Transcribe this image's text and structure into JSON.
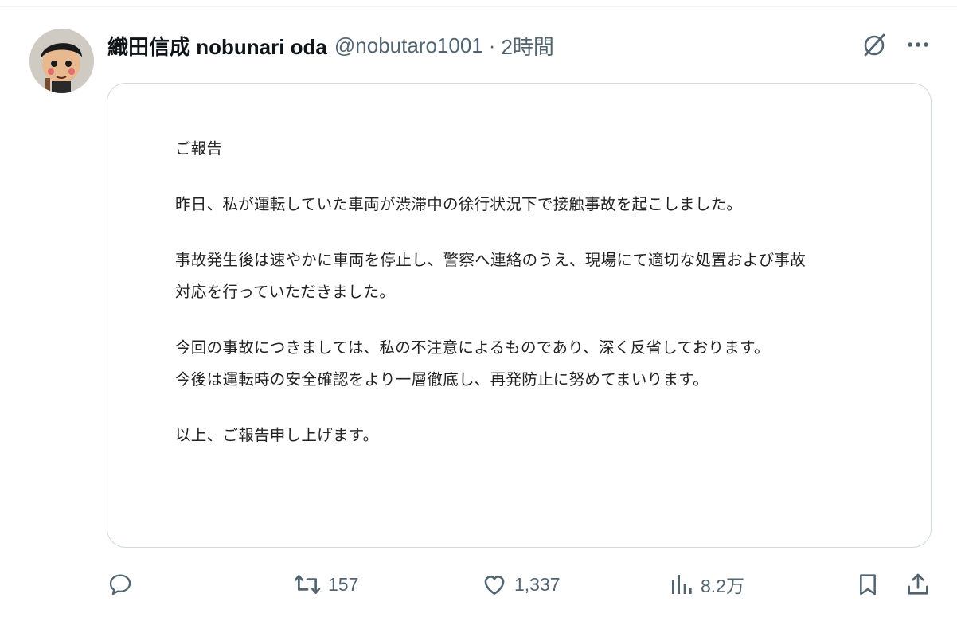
{
  "tweet": {
    "display_name": "織田信成 nobunari oda",
    "handle": "@nobutaro1001",
    "separator": "·",
    "time": "2時間",
    "avatar_icon": "profile-avatar",
    "header_icons": [
      "grok-icon",
      "more-icon"
    ]
  },
  "document": {
    "title": "ご報告",
    "paragraph1": "昨日、私が運転していた車両が渋滞中の徐行状況下で接触事故を起こしました。",
    "paragraph2_line1": "事故発生後は速やかに車両を停止し、警察へ連絡のうえ、現場にて適切な処置および事故",
    "paragraph2_line2": "対応を行っていただきました。",
    "paragraph3_line1": "今回の事故につきましては、私の不注意によるものであり、深く反省しております。",
    "paragraph3_line2": "今後は運転時の安全確認をより一層徹底し、再発防止に努めてまいります。",
    "closing": "以上、ご報告申し上げます。"
  },
  "actions": {
    "reply": {
      "icon": "reply-icon",
      "count": ""
    },
    "retweet": {
      "icon": "retweet-icon",
      "count": "157"
    },
    "like": {
      "icon": "heart-icon",
      "count": "1,337"
    },
    "views": {
      "icon": "views-icon",
      "count": "8.2万"
    },
    "bookmark": {
      "icon": "bookmark-icon"
    },
    "share": {
      "icon": "share-icon"
    }
  },
  "colors": {
    "text": "#0f1419",
    "secondary": "#536471",
    "border": "#cfd9de"
  }
}
